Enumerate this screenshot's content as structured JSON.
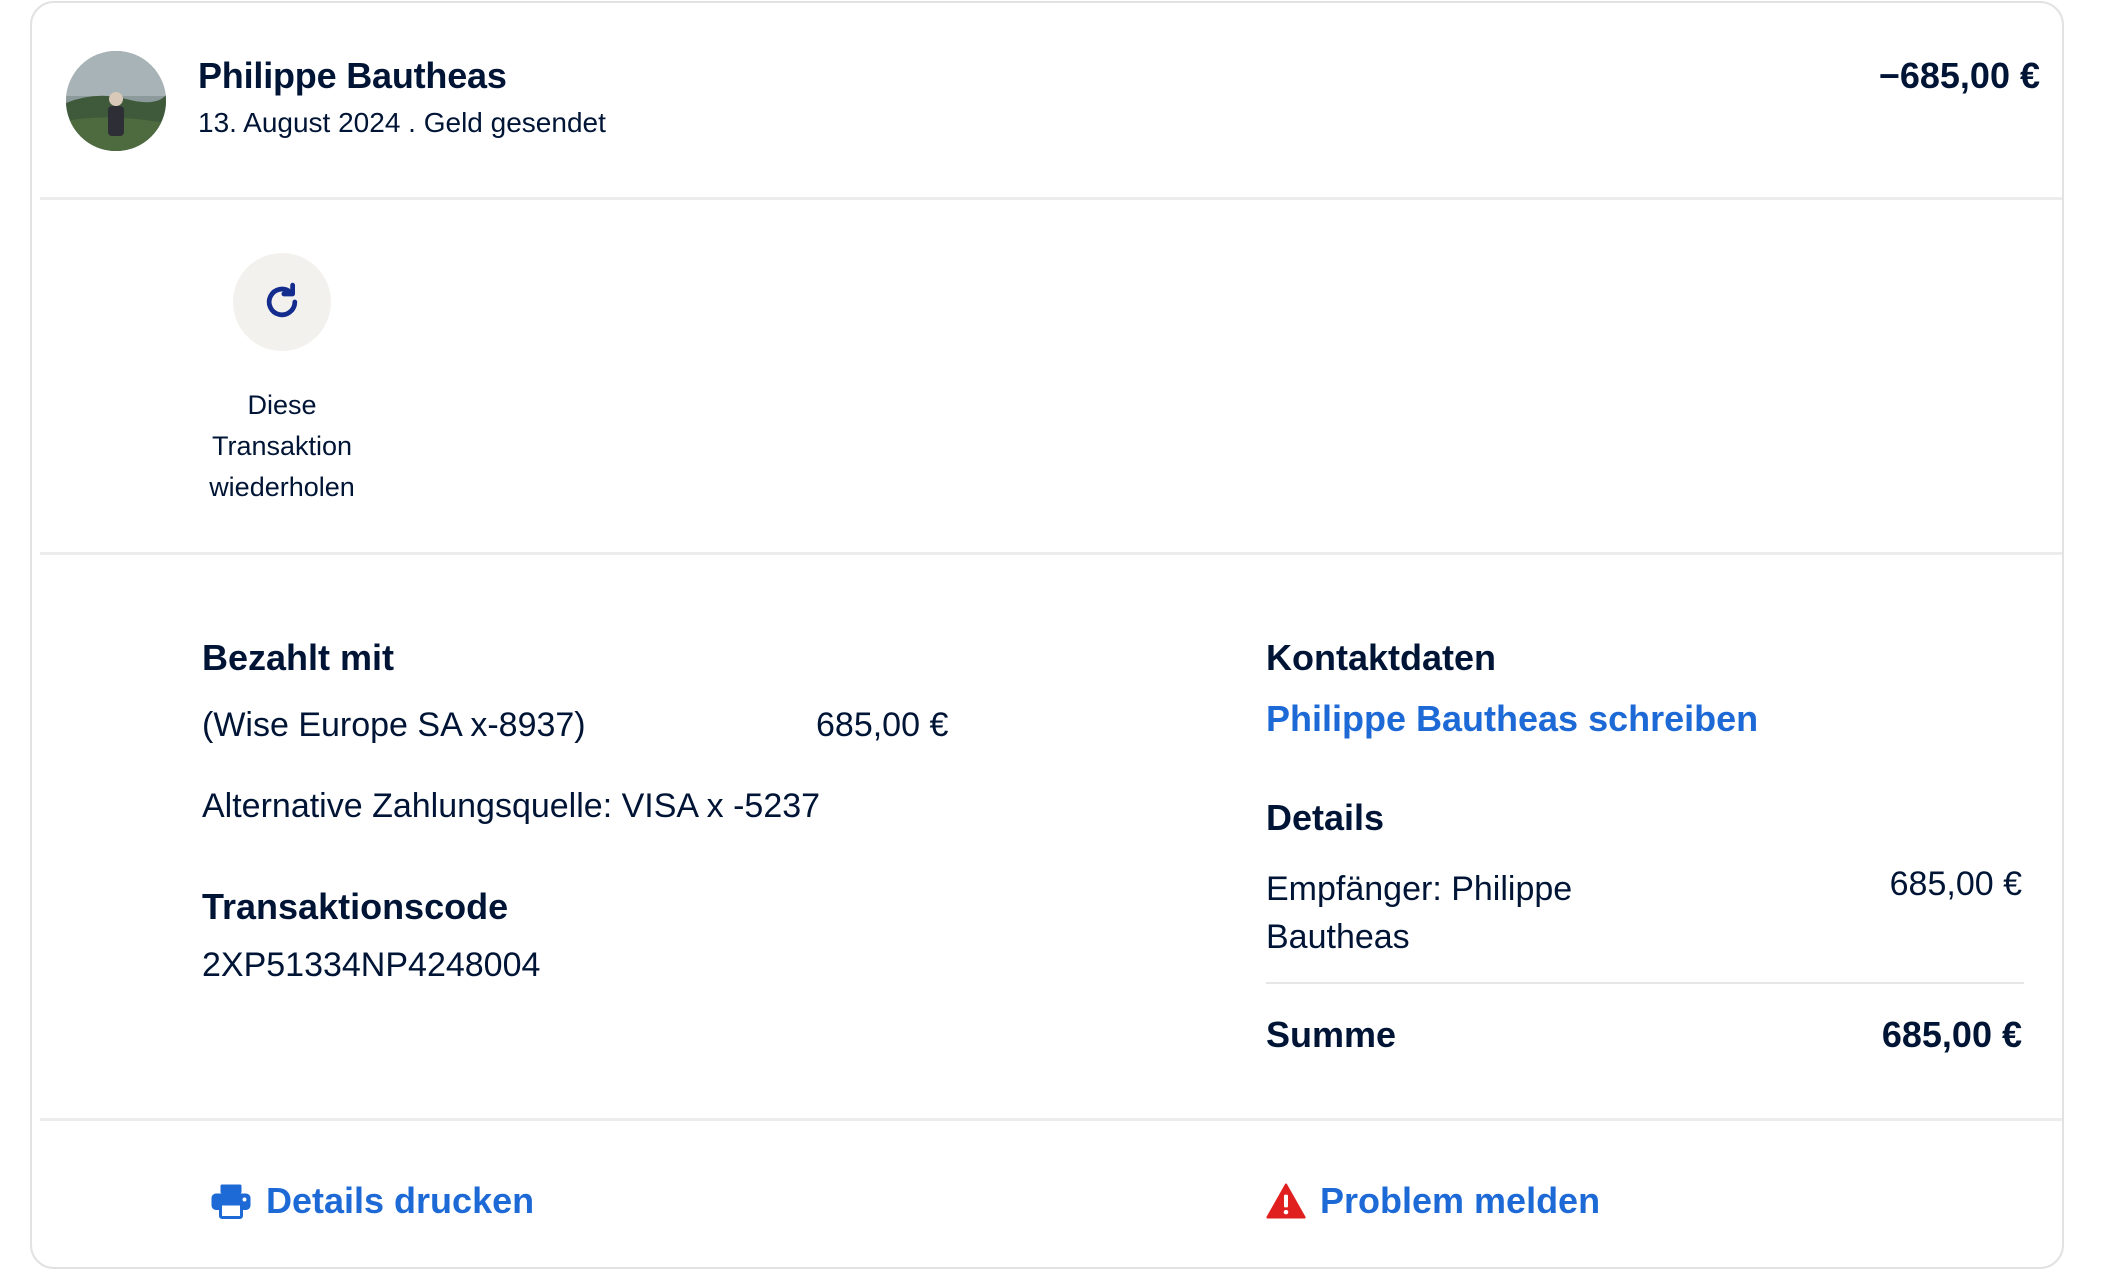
{
  "header": {
    "name": "Philippe Bautheas",
    "subtitle": "13. August 2024 . Geld gesendet",
    "amount": "−685,00 €"
  },
  "actions": {
    "repeat_label": "Diese Transaktion wiederholen"
  },
  "payment": {
    "heading": "Bezahlt mit",
    "source": "(Wise Europe SA x-8937)",
    "source_amount": "685,00 €",
    "alternative": "Alternative Zahlungsquelle: VISA x -5237"
  },
  "transaction": {
    "heading": "Transaktionscode",
    "code": "2XP51334NP4248004"
  },
  "contact": {
    "heading": "Kontaktdaten",
    "link": "Philippe Bautheas schreiben"
  },
  "details": {
    "heading": "Details",
    "recipient": "Empfänger: Philippe Bautheas",
    "recipient_amount": "685,00 €",
    "total_label": "Summe",
    "total_amount": "685,00 €"
  },
  "footer": {
    "print_label": "Details drucken",
    "report_label": "Problem melden"
  },
  "colors": {
    "accent": "#1d6ad7",
    "text": "#001435",
    "warning": "#e0201f"
  },
  "icons": [
    "refresh-icon",
    "printer-icon",
    "warning-icon"
  ]
}
